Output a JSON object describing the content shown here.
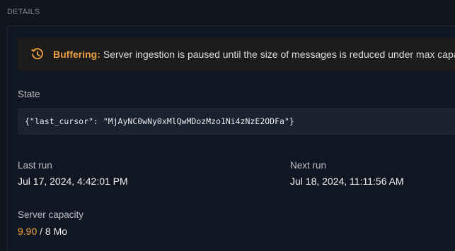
{
  "section": {
    "title": "DETAILS"
  },
  "banner": {
    "icon": "clock-refresh-icon",
    "title": "Buffering:",
    "message": "Server ingestion is paused until the size of messages is reduced under max capacity",
    "accent_color": "#e9a23b"
  },
  "state": {
    "label": "State",
    "value": "{\"last_cursor\": \"MjAyNC0wNy0xMlQwMDozMzo1Ni4zNzE2ODFa\"}"
  },
  "last_run": {
    "label": "Last run",
    "value": "Jul 17, 2024, 4:42:01 PM"
  },
  "next_run": {
    "label": "Next run",
    "value": "Jul 18, 2024, 11:11:56 AM"
  },
  "capacity": {
    "label": "Server capacity",
    "used": "9.90",
    "separator": " / ",
    "max": "8 Mo",
    "used_color": "#f0a33c"
  }
}
